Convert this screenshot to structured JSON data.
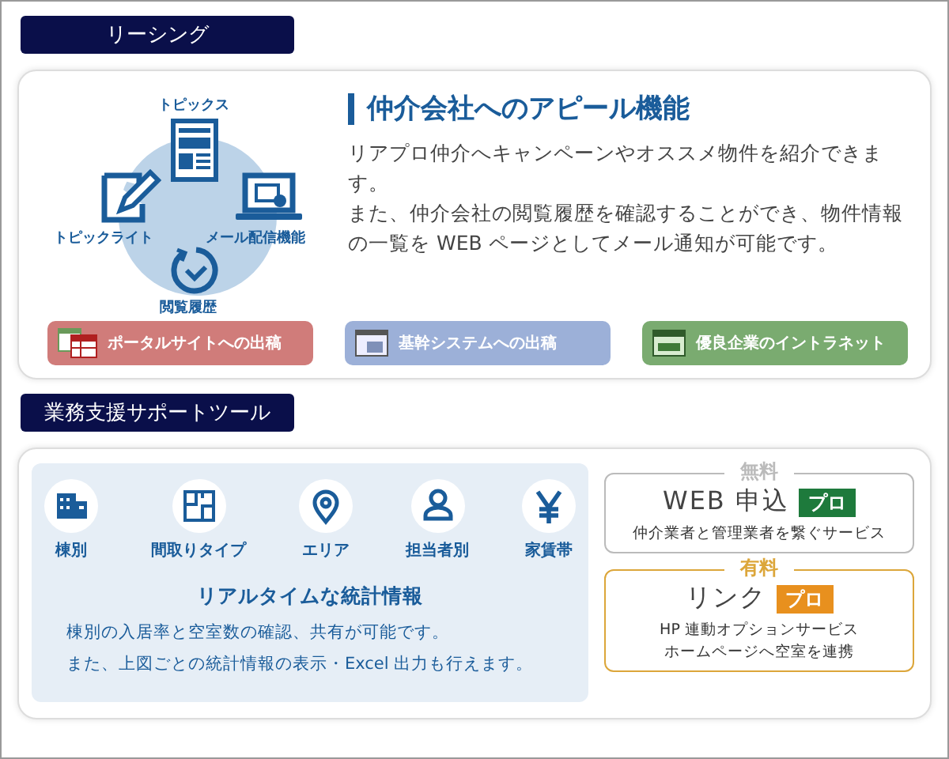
{
  "leasing": {
    "header": "リーシング",
    "diagram": {
      "labels": [
        {
          "kind": "top",
          "text": "トピックス"
        },
        {
          "kind": "left",
          "text": "トピックライト"
        },
        {
          "kind": "right",
          "text": "メール配信機能"
        },
        {
          "kind": "bottom",
          "text": "閲覧履歴"
        }
      ]
    },
    "heading": "仲介会社へのアピール機能",
    "paragraphs": [
      "リアプロ仲介へキャンペーンやオススメ物件を紹介できます。",
      "また、仲介会社の閲覧履歴を確認することができ、物件情報の一覧を WEB ページとしてメール通知が可能です。"
    ],
    "links": [
      {
        "label": "ポータルサイトへの出稿",
        "color": "#d07c7a"
      },
      {
        "label": "基幹システムへの出稿",
        "color": "#9cb0d8"
      },
      {
        "label": "優良企業のイントラネット",
        "color": "#7aab70"
      }
    ]
  },
  "support": {
    "header": "業務支援サポートツール",
    "stats": {
      "items": [
        {
          "label": "棟別"
        },
        {
          "label": "間取りタイプ"
        },
        {
          "label": "エリア"
        },
        {
          "label": "担当者別"
        },
        {
          "label": "家賃帯"
        }
      ],
      "heading": "リアルタイムな統計情報",
      "lines": [
        "棟別の入居率と空室数の確認、共有が可能です。",
        "また、上図ごとの統計情報の表示・Excel 出力も行えます。"
      ]
    },
    "plans": [
      {
        "tag": "無料",
        "name": "WEB 申込",
        "badge": "プロ",
        "desc": [
          "仲介業者と管理業者を繋ぐサービス"
        ],
        "color": "#bbbbbb"
      },
      {
        "tag": "有料",
        "name": "リンク",
        "badge": "プロ",
        "desc": [
          "HP 連動オプションサービス",
          "ホームページへ空室を連携"
        ],
        "color": "#dca63a"
      }
    ]
  }
}
